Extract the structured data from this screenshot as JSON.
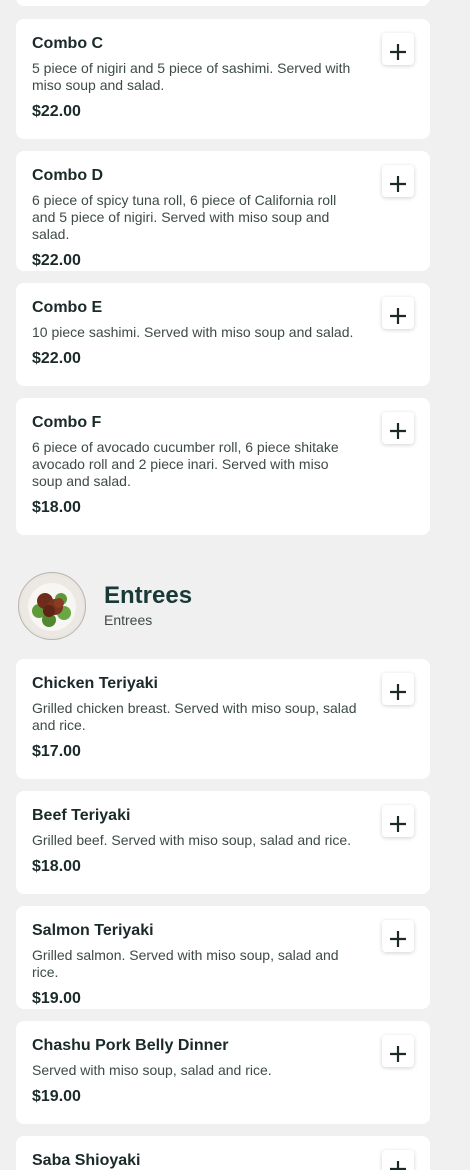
{
  "section": {
    "title": "Entrees",
    "subtitle": "Entrees",
    "image_icon": "food-plate-icon"
  },
  "add_icon": "plus-icon",
  "items": [
    {
      "name": "Combo C",
      "description": "5 piece of nigiri and 5 piece of sashimi. Served with miso soup and salad.",
      "price": "$22.00"
    },
    {
      "name": "Combo D",
      "description": "6 piece of spicy tuna roll, 6 piece of California roll and 5 piece of nigiri. Served with miso soup and salad.",
      "price": "$22.00"
    },
    {
      "name": "Combo E",
      "description": "10 piece sashimi. Served with miso soup and salad.",
      "price": "$22.00"
    },
    {
      "name": "Combo F",
      "description": "6 piece of avocado cucumber roll, 6 piece shitake avocado roll and 2 piece inari. Served with miso soup and salad.",
      "price": "$18.00"
    },
    {
      "name": "Chicken Teriyaki",
      "description": "Grilled chicken breast. Served with miso soup, salad and rice.",
      "price": "$17.00"
    },
    {
      "name": "Beef Teriyaki",
      "description": "Grilled beef. Served with miso soup, salad and rice.",
      "price": "$18.00"
    },
    {
      "name": "Salmon Teriyaki",
      "description": "Grilled salmon. Served with miso soup, salad and rice.",
      "price": "$19.00"
    },
    {
      "name": "Chashu Pork Belly Dinner",
      "description": "Served with miso soup, salad and rice.",
      "price": "$19.00"
    },
    {
      "name": "Saba Shioyaki",
      "description": "",
      "price": ""
    }
  ]
}
